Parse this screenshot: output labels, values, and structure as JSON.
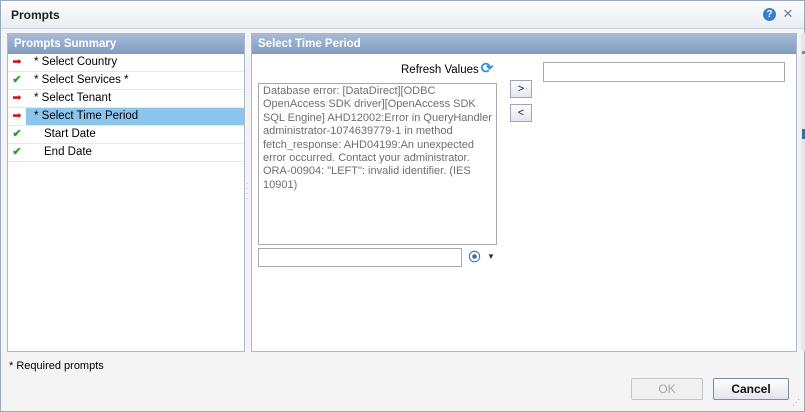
{
  "dialog": {
    "title": "Prompts",
    "help_icon": "help-icon",
    "close_icon": "close-icon"
  },
  "summary": {
    "header": "Prompts Summary",
    "items": [
      {
        "label": "* Select Country",
        "status": "arrow",
        "selected": false
      },
      {
        "label": "* Select Services *",
        "status": "check",
        "selected": false
      },
      {
        "label": "* Select Tenant",
        "status": "arrow",
        "selected": false
      },
      {
        "label": "* Select Time Period",
        "status": "arrow",
        "selected": true
      },
      {
        "label": "Start Date",
        "status": "check",
        "selected": false
      },
      {
        "label": "End Date",
        "status": "check",
        "selected": false
      }
    ]
  },
  "detail": {
    "header": "Select Time Period",
    "refresh_label": "Refresh Values",
    "refresh_icon": "refresh-icon",
    "values_text": "Database error: [DataDirect][ODBC OpenAccess SDK driver][OpenAccess SDK SQL Engine] AHD12002:Error in QueryHandler administrator-1074639779-1 in method fetch_response: AHD04199:An unexpected error occurred. Contact your administrator. ORA-00904: \"LEFT\": invalid identifier. (IES 10901)",
    "add_button": ">",
    "remove_button": "<",
    "search_value": "",
    "selected_value": "",
    "search_icon": "binoculars-icon",
    "search_options_icon": "chevron-down-icon"
  },
  "footer": {
    "required_note": "* Required prompts",
    "ok_label": "OK",
    "cancel_label": "Cancel"
  },
  "colors": {
    "header_blue": "#8fa8cc",
    "selected_row": "#8cc6ef",
    "arrow_red": "#cc1a1a",
    "check_green": "#2c9a2c"
  }
}
